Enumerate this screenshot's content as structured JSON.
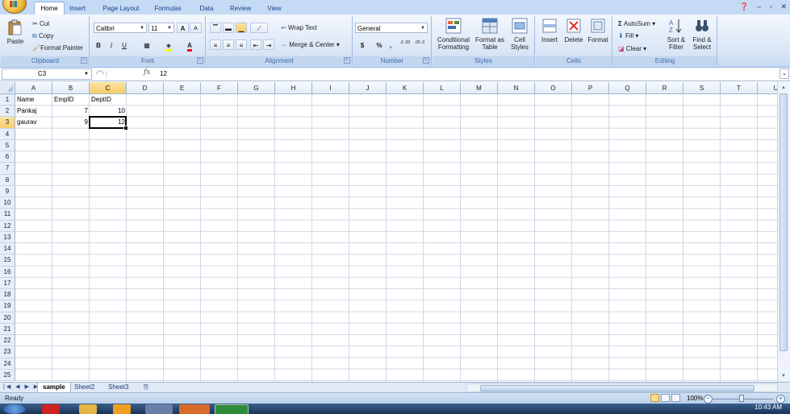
{
  "ribbon_tabs": [
    "Home",
    "Insert",
    "Page Layout",
    "Formulas",
    "Data",
    "Review",
    "View"
  ],
  "active_tab": "Home",
  "clipboard": {
    "paste": "Paste",
    "cut": "Cut",
    "copy": "Copy",
    "format_painter": "Format Painter",
    "title": "Clipboard"
  },
  "font": {
    "name": "Calibri",
    "size": "11",
    "grow": "A",
    "shrink": "A",
    "bold": "B",
    "italic": "I",
    "underline": "U",
    "fill_color": "#ffff00",
    "font_color": "#ff0000",
    "title": "Font"
  },
  "alignment": {
    "wrap_text": "Wrap Text",
    "merge_center": "Merge & Center",
    "title": "Alignment"
  },
  "number": {
    "format": "General",
    "currency": "$",
    "percent": "%",
    "comma": ",",
    "inc_decimal": ".0 .00",
    "dec_decimal": ".00 .0",
    "title": "Number"
  },
  "styles": {
    "conditional_formatting": "Conditional Formatting",
    "format_as_table": "Format as Table",
    "cell_styles": "Cell Styles",
    "title": "Styles"
  },
  "cells_group": {
    "insert": "Insert",
    "delete": "Delete",
    "format": "Format",
    "title": "Cells"
  },
  "editing": {
    "autosum": "AutoSum",
    "fill": "Fill",
    "clear": "Clear",
    "sort_filter": "Sort & Filter",
    "find_select": "Find & Select",
    "title": "Editing"
  },
  "formula_bar": {
    "name_box": "C3",
    "fx": "fx",
    "content": "12"
  },
  "columns": [
    "A",
    "B",
    "C",
    "D",
    "E",
    "F",
    "G",
    "H",
    "I",
    "J",
    "K",
    "L",
    "M",
    "N",
    "O",
    "P",
    "Q",
    "R",
    "S",
    "T",
    "U"
  ],
  "selected_column": "C",
  "rows": [
    "1",
    "2",
    "3",
    "4",
    "5",
    "6",
    "7",
    "8",
    "9",
    "10",
    "11",
    "12",
    "13",
    "14",
    "15",
    "16",
    "17",
    "18",
    "19",
    "20",
    "21",
    "22",
    "23",
    "24",
    "25"
  ],
  "selected_row": "3",
  "cells": [
    {
      "col": "A",
      "row": "1",
      "value": "Name",
      "numeric": false
    },
    {
      "col": "B",
      "row": "1",
      "value": "EmpID",
      "numeric": false
    },
    {
      "col": "C",
      "row": "1",
      "value": "DeptID",
      "numeric": false
    },
    {
      "col": "A",
      "row": "2",
      "value": "Pankaj",
      "numeric": false
    },
    {
      "col": "B",
      "row": "2",
      "value": "7",
      "numeric": true
    },
    {
      "col": "C",
      "row": "2",
      "value": "10",
      "numeric": true
    },
    {
      "col": "A",
      "row": "3",
      "value": "gaurav",
      "numeric": false
    },
    {
      "col": "B",
      "row": "3",
      "value": "9",
      "numeric": true
    },
    {
      "col": "C",
      "row": "3",
      "value": "12",
      "numeric": true
    }
  ],
  "sheet_tabs": [
    "sample",
    "Sheet2",
    "Sheet3"
  ],
  "active_sheet": "sample",
  "status": {
    "ready": "Ready",
    "zoom": "100%"
  },
  "clock": "10:43 AM",
  "colors": {
    "ribbon_bg": "#dae6f6",
    "tab_text": "#15428b",
    "selected_header": "#f8cc6a",
    "grid_line": "#d0d7e5",
    "taskbar": "#1b3457"
  }
}
